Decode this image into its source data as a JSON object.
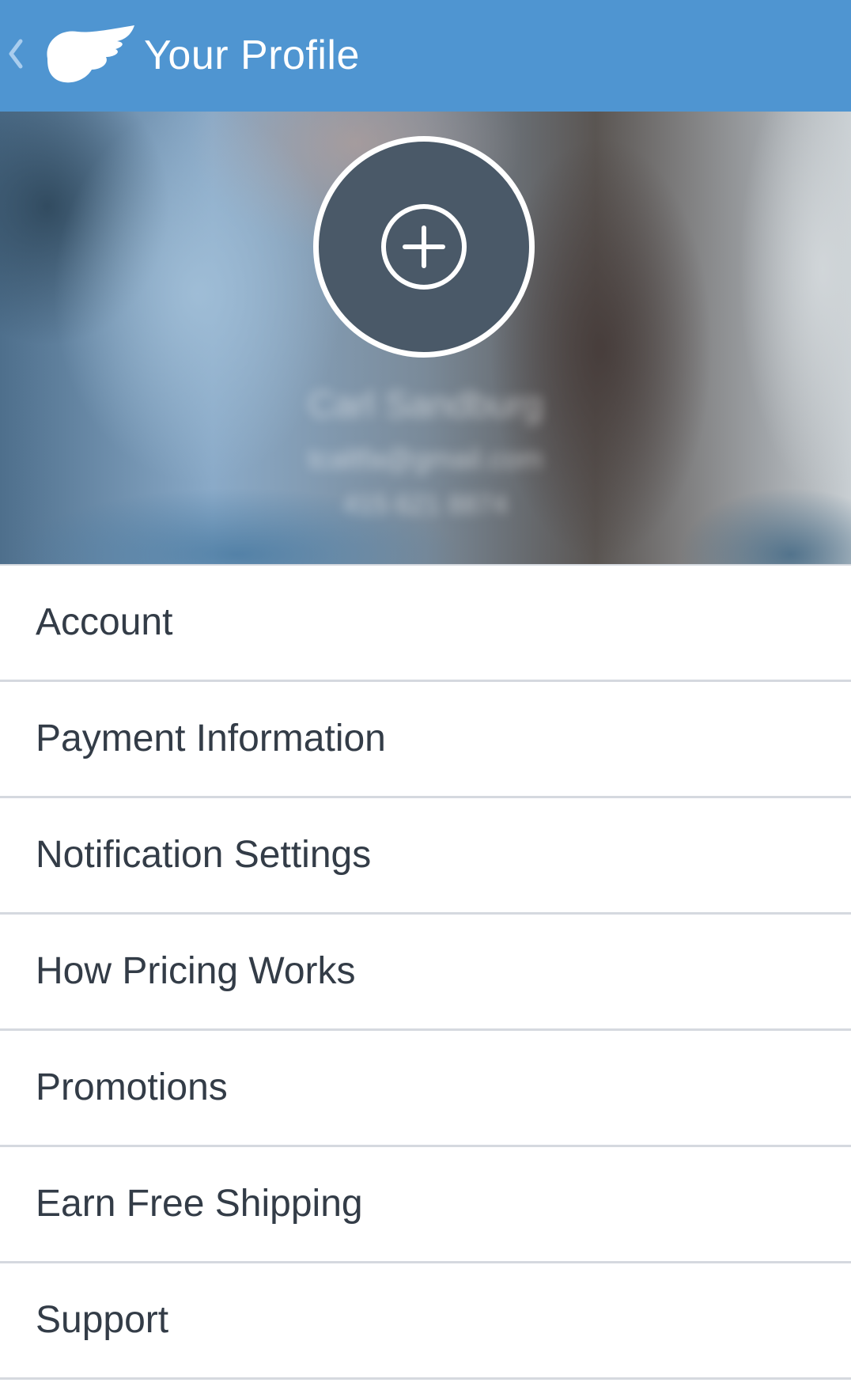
{
  "header": {
    "title": "Your Profile",
    "back_icon": "chevron-left-icon",
    "logo_icon": "wing-logo-icon",
    "background_color": "#4f95d1"
  },
  "profile": {
    "avatar_action_icon": "plus-circle-icon",
    "avatar_color": "#4a5968",
    "name": "Carl Sandburg",
    "email": "tcaltfa@gmail.com",
    "phone": "415 621 8874"
  },
  "menu": {
    "items": [
      {
        "label": "Account"
      },
      {
        "label": "Payment Information"
      },
      {
        "label": "Notification Settings"
      },
      {
        "label": "How Pricing Works"
      },
      {
        "label": "Promotions"
      },
      {
        "label": "Earn Free Shipping"
      },
      {
        "label": "Support"
      }
    ],
    "text_color": "#333c47",
    "divider_color": "#d5d9df"
  }
}
